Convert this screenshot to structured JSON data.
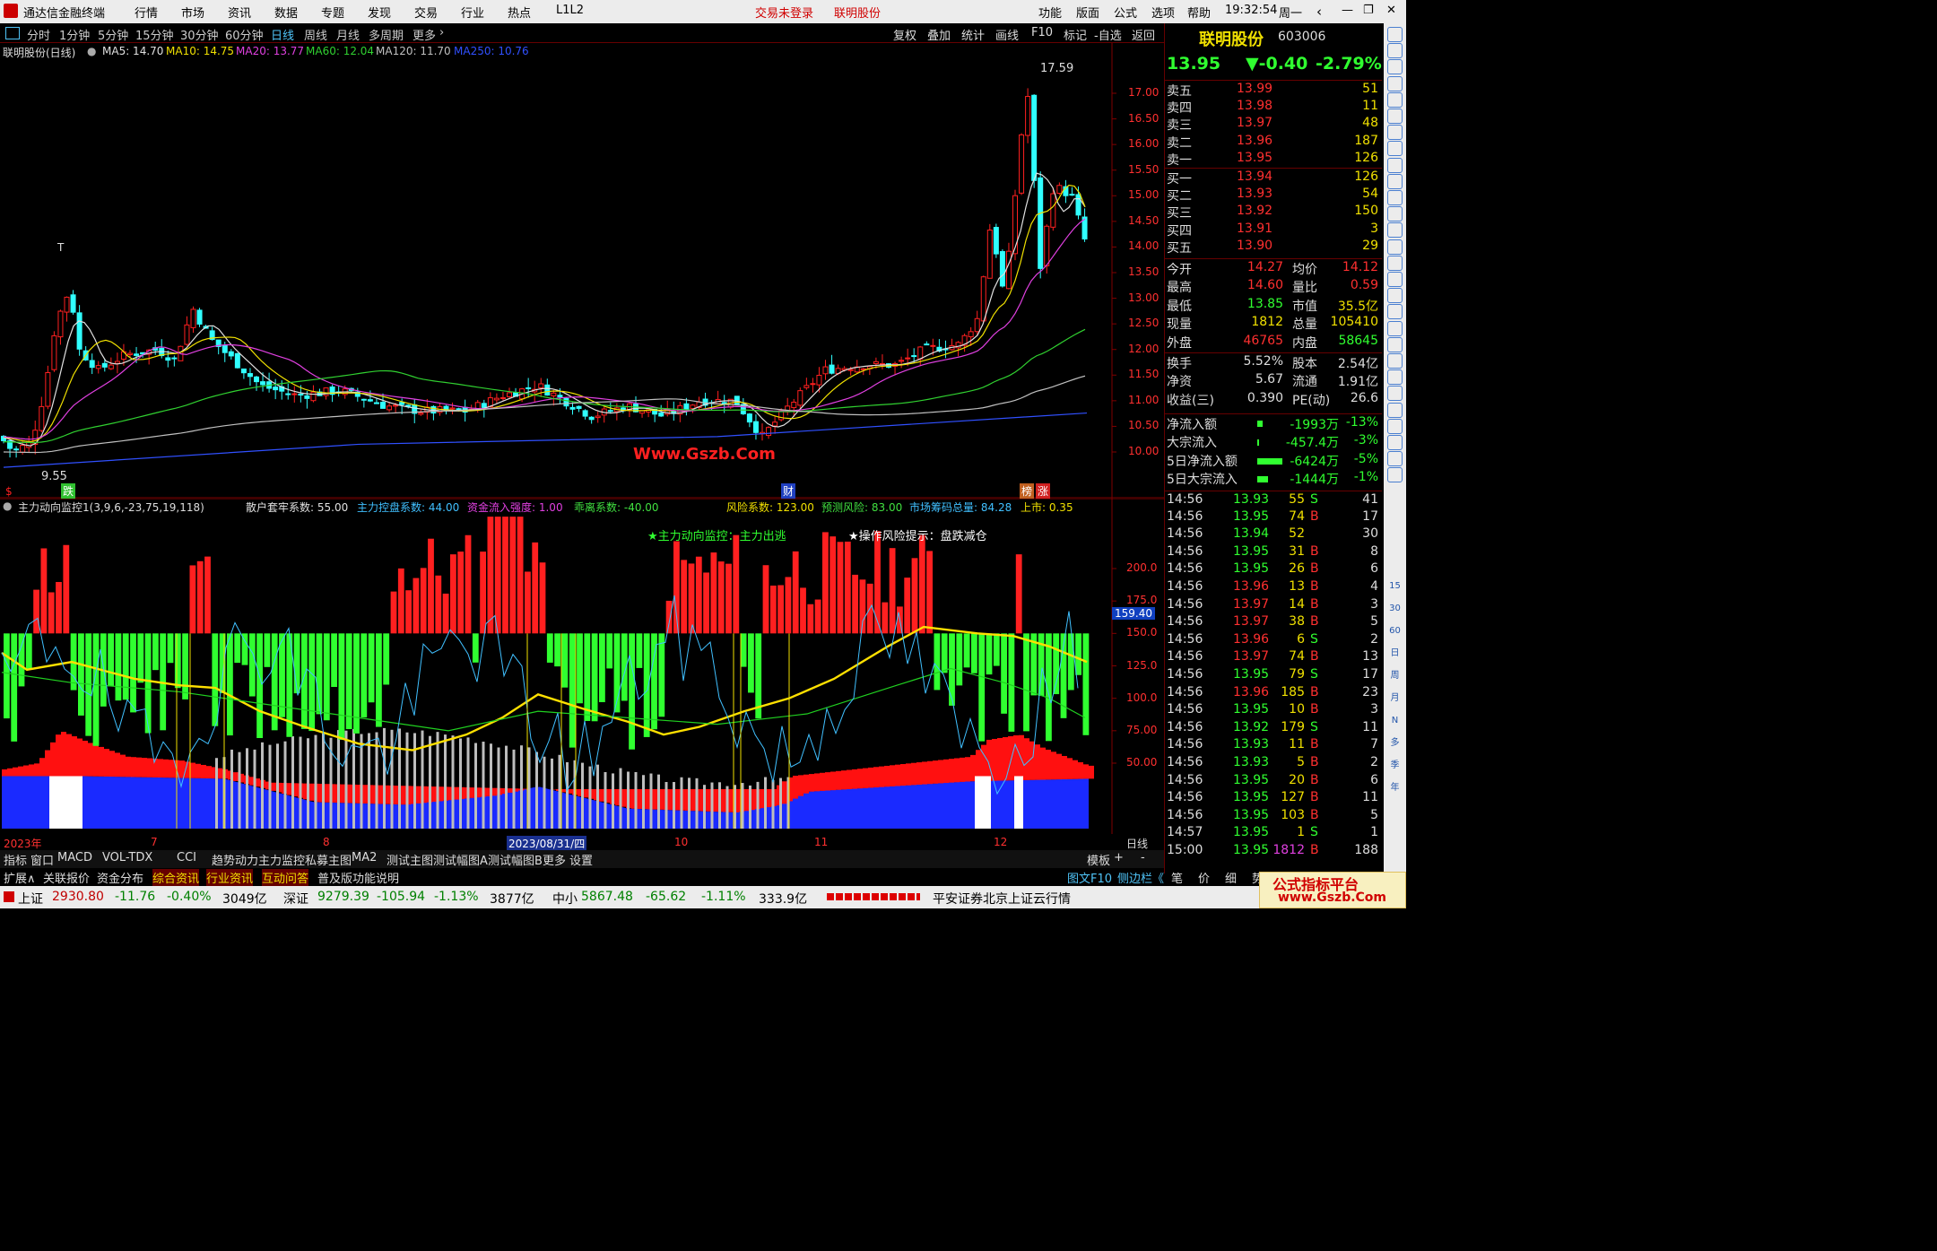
{
  "menu": {
    "app_title": "通达信金融终端",
    "items": [
      "行情",
      "市场",
      "资讯",
      "数据",
      "专题",
      "发现",
      "交易",
      "行业",
      "热点",
      "L1L2"
    ],
    "trade_status": "交易未登录",
    "stock_name": "联明股份",
    "right_items": [
      "功能",
      "版面",
      "公式",
      "选项",
      "帮助"
    ],
    "time": "19:32:54",
    "weekday": "周一"
  },
  "timeframes": [
    "分时",
    "1分钟",
    "5分钟",
    "15分钟",
    "30分钟",
    "60分钟",
    "日线",
    "周线",
    "月线",
    "多周期",
    "更多"
  ],
  "toolbar": [
    "复权",
    "叠加",
    "统计",
    "画线",
    "F10",
    "标记",
    "-自选",
    "返回"
  ],
  "ma_legend": {
    "name": "联明股份(日线)",
    "items": [
      {
        "label": "MA5: 14.70",
        "color": "#e0e0e0"
      },
      {
        "label": "MA10: 14.75",
        "color": "#f0e000"
      },
      {
        "label": "MA20: 13.77",
        "color": "#e040e0"
      },
      {
        "label": "MA60: 12.04",
        "color": "#30d030"
      },
      {
        "label": "MA120: 11.70",
        "color": "#c0c0c0"
      },
      {
        "label": "MA250: 10.76",
        "color": "#3050ff"
      }
    ]
  },
  "price_axis": [
    "17.00",
    "16.50",
    "16.00",
    "15.50",
    "15.00",
    "14.50",
    "14.00",
    "13.50",
    "13.00",
    "12.50",
    "12.00",
    "11.50",
    "11.00",
    "10.50",
    "10.00"
  ],
  "annotations": {
    "high": "17.59",
    "low": "9.55",
    "watermark": "Www.Gszb.Com",
    "marker_t": "T",
    "marker_die": "跌",
    "marker_cai": "财",
    "marker_bang": "榜",
    "marker_zhang": "涨",
    "marker_s": "$"
  },
  "indicator_header": {
    "name": "主力动向监控1(3,9,6,-23,75,19,118)",
    "fields": [
      {
        "label": "散户套牢系数: 55.00",
        "color": "#e0e0e0"
      },
      {
        "label": "主力控盘系数: 44.00",
        "color": "#40c0ff"
      },
      {
        "label": "资金流入强度: 1.00",
        "color": "#e040e0"
      },
      {
        "label": "乖离系数: -40.00",
        "color": "#40e040"
      },
      {
        "label": "风险系数: 123.00",
        "color": "#f0e000"
      },
      {
        "label": "预测风险: 83.00",
        "color": "#40e040"
      },
      {
        "label": "市场筹码总量: 84.28",
        "color": "#40c0ff"
      },
      {
        "label": "上市: 0.35",
        "color": "#f0e000"
      }
    ]
  },
  "indicator_notes": {
    "signal": "★主力动向监控：主力出逃",
    "risk": "★操作风险提示：盘跌减仓"
  },
  "indicator_axis": [
    "200.0",
    "175.0",
    "150.0",
    "125.0",
    "100.0",
    "75.00",
    "50.00"
  ],
  "indicator_current": "159.40",
  "date_axis": [
    "2023年",
    "7",
    "8",
    "2023/08/31/四",
    "10",
    "11",
    "12"
  ],
  "period_label": "日线",
  "quote": {
    "name": "联明股份",
    "code": "603006",
    "price": "13.95",
    "change": "▼-0.40",
    "pct": "-2.79%",
    "asks": [
      [
        "卖五",
        "13.99",
        "51"
      ],
      [
        "卖四",
        "13.98",
        "11"
      ],
      [
        "卖三",
        "13.97",
        "48"
      ],
      [
        "卖二",
        "13.96",
        "187"
      ],
      [
        "卖一",
        "13.95",
        "126"
      ]
    ],
    "bids": [
      [
        "买一",
        "13.94",
        "126"
      ],
      [
        "买二",
        "13.93",
        "54"
      ],
      [
        "买三",
        "13.92",
        "150"
      ],
      [
        "买四",
        "13.91",
        "3"
      ],
      [
        "买五",
        "13.90",
        "29"
      ]
    ],
    "stats": [
      [
        "今开",
        "14.27",
        "均价",
        "14.12"
      ],
      [
        "最高",
        "14.60",
        "量比",
        "0.59"
      ],
      [
        "最低",
        "13.85",
        "市值",
        "35.5亿"
      ],
      [
        "现量",
        "1812",
        "总量",
        "105410"
      ],
      [
        "外盘",
        "46765",
        "内盘",
        "58645"
      ]
    ],
    "stats2": [
      [
        "换手",
        "5.52%",
        "股本",
        "2.54亿"
      ],
      [
        "净资",
        "5.67",
        "流通",
        "1.91亿"
      ],
      [
        "收益(三)",
        "0.390",
        "PE(动)",
        "26.6"
      ]
    ],
    "flows": [
      [
        "净流入额",
        "-1993万",
        "-13%"
      ],
      [
        "大宗流入",
        "-457.4万",
        "-3%"
      ],
      [
        "5日净流入额",
        "-6424万",
        "-5%"
      ],
      [
        "5日大宗流入",
        "-1444万",
        "-1%"
      ]
    ],
    "ticks": [
      [
        "14:56",
        "13.93",
        "55",
        "S",
        "41"
      ],
      [
        "14:56",
        "13.95",
        "74",
        "B",
        "17"
      ],
      [
        "14:56",
        "13.94",
        "52",
        "",
        "30"
      ],
      [
        "14:56",
        "13.95",
        "31",
        "B",
        "8"
      ],
      [
        "14:56",
        "13.95",
        "26",
        "B",
        "6"
      ],
      [
        "14:56",
        "13.96",
        "13",
        "B",
        "4"
      ],
      [
        "14:56",
        "13.97",
        "14",
        "B",
        "3"
      ],
      [
        "14:56",
        "13.97",
        "38",
        "B",
        "5"
      ],
      [
        "14:56",
        "13.96",
        "6",
        "S",
        "2"
      ],
      [
        "14:56",
        "13.97",
        "74",
        "B",
        "13"
      ],
      [
        "14:56",
        "13.95",
        "79",
        "S",
        "17"
      ],
      [
        "14:56",
        "13.96",
        "185",
        "B",
        "23"
      ],
      [
        "14:56",
        "13.95",
        "10",
        "B",
        "3"
      ],
      [
        "14:56",
        "13.92",
        "179",
        "S",
        "11"
      ],
      [
        "14:56",
        "13.93",
        "11",
        "B",
        "7"
      ],
      [
        "14:56",
        "13.93",
        "5",
        "B",
        "2"
      ],
      [
        "14:56",
        "13.95",
        "20",
        "B",
        "6"
      ],
      [
        "14:56",
        "13.95",
        "127",
        "B",
        "11"
      ],
      [
        "14:56",
        "13.95",
        "103",
        "B",
        "5"
      ],
      [
        "14:57",
        "13.95",
        "1",
        "S",
        "1"
      ],
      [
        "15:00",
        "13.95",
        "1812",
        "B",
        "188"
      ]
    ]
  },
  "side_tools": [
    "Fi",
    "日",
    "周",
    "月",
    "N",
    "多",
    "季",
    "年",
    "15",
    "30",
    "60",
    "Ba",
    "Fs",
    "RSI"
  ],
  "bottom_tabs": [
    "指标",
    "窗口",
    "MACD",
    "VOL-TDX",
    "CCI",
    "趋势动力",
    "主力监控",
    "私募主图",
    "MA2",
    "测试主图",
    "测试幅图A",
    "测试幅图B",
    "更多",
    "设置"
  ],
  "bottom_right": [
    "模板",
    "+",
    "-"
  ],
  "sub_tabs": [
    "扩展∧",
    "关联报价",
    "资金分布",
    "综合资讯",
    "行业资讯",
    "互动问答",
    "普及版功能说明"
  ],
  "sub_right": [
    "图文F10",
    "侧边栏《",
    "笔",
    "价",
    "细",
    "势"
  ],
  "status": {
    "sh": "上证",
    "sh_val": "2930.80",
    "sh_chg": "-11.76",
    "sh_pct": "-0.40%",
    "sh_amt": "3049亿",
    "sz": "深证",
    "sz_val": "9279.39",
    "sz_chg": "-105.94",
    "sz_pct": "-1.13%",
    "sz_amt": "3877亿",
    "zx": "中小",
    "zx_val": "5867.48",
    "zx_chg": "-65.62",
    "zx_pct": "-1.11%",
    "zx_amt": "333.9亿",
    "broker": "平安证券北京上证云行情",
    "logo": "公式指标平台",
    "logo_url": "www.Gszb.Com"
  },
  "colors": {
    "up": "#ff2020",
    "down": "#30ffff",
    "accent": "#4fc3f7"
  }
}
